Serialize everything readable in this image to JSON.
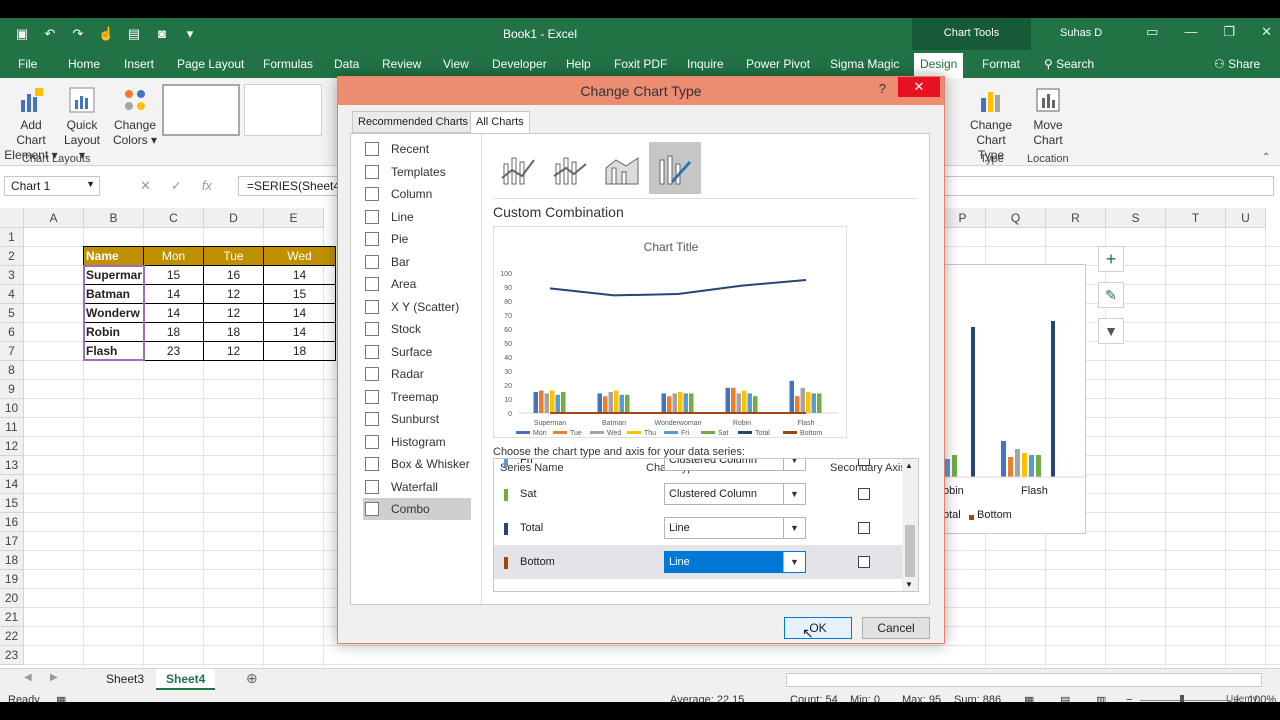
{
  "window": {
    "doc_title": "Book1 - Excel",
    "context_tab_group": "Chart Tools",
    "user": "Suhas D",
    "share_label": "Share",
    "search_label": "Search"
  },
  "ribbon_tabs": [
    "File",
    "Home",
    "Insert",
    "Page Layout",
    "Formulas",
    "Data",
    "Review",
    "View",
    "Developer",
    "Help",
    "Foxit PDF",
    "Inquire",
    "Power Pivot",
    "Sigma Magic",
    "Design",
    "Format"
  ],
  "ribbon": {
    "add_chart_element": [
      "Add Chart",
      "Element ▾"
    ],
    "quick_layout": [
      "Quick",
      "Layout ▾"
    ],
    "change_colors": [
      "Change",
      "Colors ▾"
    ],
    "chart_layouts_label": "Chart Layouts",
    "change_chart_type": [
      "Change",
      "Chart Type"
    ],
    "type_label": "Type",
    "move_chart": [
      "Move",
      "Chart"
    ],
    "location_label": "Location"
  },
  "formula_bar": {
    "name_box": "Chart 1",
    "formula": "=SERIES(Sheet4"
  },
  "columns": [
    "A",
    "B",
    "C",
    "D",
    "E",
    "P",
    "Q",
    "R",
    "S",
    "T",
    "U"
  ],
  "rows": [
    "1",
    "2",
    "3",
    "4",
    "5",
    "6",
    "7",
    "8",
    "9",
    "10",
    "11",
    "12",
    "13",
    "14",
    "15",
    "16",
    "17",
    "18",
    "19",
    "20",
    "21",
    "22",
    "23"
  ],
  "table": {
    "headers": [
      "Name",
      "Mon",
      "Tue",
      "Wed"
    ],
    "rows": [
      [
        "Supermar",
        "15",
        "16",
        "14"
      ],
      [
        "Batman",
        "14",
        "12",
        "15"
      ],
      [
        "Wonderw",
        "14",
        "12",
        "14"
      ],
      [
        "Robin",
        "18",
        "18",
        "14"
      ],
      [
        "Flash",
        "23",
        "12",
        "18"
      ]
    ]
  },
  "dialog": {
    "title": "Change Chart Type",
    "help": "?",
    "close": "✕",
    "tabs": [
      "Recommended Charts",
      "All Charts"
    ],
    "chart_types": [
      "Recent",
      "Templates",
      "Column",
      "Line",
      "Pie",
      "Bar",
      "Area",
      "X Y (Scatter)",
      "Stock",
      "Surface",
      "Radar",
      "Treemap",
      "Sunburst",
      "Histogram",
      "Box & Whisker",
      "Waterfall",
      "Combo"
    ],
    "selected_type": "Combo",
    "combo_title": "Custom Combination",
    "choose_label": "Choose the chart type and axis for your data series:",
    "table_headers": [
      "Series Name",
      "Chart Type",
      "Secondary Axis"
    ],
    "series_rows": [
      {
        "name": "Fri",
        "type": "Clustered Column",
        "color": "#5b9bd5"
      },
      {
        "name": "Sat",
        "type": "Clustered Column",
        "color": "#70ad47"
      },
      {
        "name": "Total",
        "type": "Line",
        "color": "#264478"
      },
      {
        "name": "Bottom",
        "type": "Line",
        "color": "#9e480e"
      }
    ],
    "ok_label": "OK",
    "cancel_label": "Cancel"
  },
  "chart_data": {
    "type": "bar",
    "title": "Chart Title",
    "categories": [
      "Superman",
      "Batman",
      "Wonderwoman",
      "Robin",
      "Flash"
    ],
    "ylim": [
      0,
      100
    ],
    "yticks": [
      "100",
      "90",
      "80",
      "70",
      "60",
      "50",
      "40",
      "30",
      "20",
      "10",
      "0"
    ],
    "series": [
      {
        "name": "Mon",
        "color": "#4472c4",
        "values": [
          15,
          14,
          14,
          18,
          23
        ]
      },
      {
        "name": "Tue",
        "color": "#ed7d31",
        "values": [
          16,
          12,
          12,
          18,
          12
        ]
      },
      {
        "name": "Wed",
        "color": "#a5a5a5",
        "values": [
          14,
          15,
          14,
          14,
          18
        ]
      },
      {
        "name": "Thu",
        "color": "#ffc000",
        "values": [
          16,
          16,
          15,
          16,
          15
        ]
      },
      {
        "name": "Fri",
        "color": "#5b9bd5",
        "values": [
          13,
          13,
          14,
          14,
          14
        ]
      },
      {
        "name": "Sat",
        "color": "#70ad47",
        "values": [
          15,
          13,
          14,
          12,
          14
        ]
      },
      {
        "name": "Total",
        "color": "#264478",
        "line": true,
        "values": [
          89,
          84,
          85,
          91,
          95
        ]
      },
      {
        "name": "Bottom",
        "color": "#9e480e",
        "line": true,
        "values": [
          0,
          0,
          0,
          0,
          0
        ]
      }
    ]
  },
  "bg_chart": {
    "labels": [
      "obin",
      "Flash"
    ],
    "legend": [
      "otal",
      "Bottom"
    ]
  },
  "sheets": [
    "Sheet3",
    "Sheet4"
  ],
  "active_sheet": "Sheet4",
  "status": {
    "ready": "Ready",
    "average": "Average: 22.15",
    "count": "Count: 54",
    "min": "Min: 0",
    "max": "Max: 95",
    "sum": "Sum: 886",
    "zoom": "100%"
  },
  "watermark": "Udemy"
}
